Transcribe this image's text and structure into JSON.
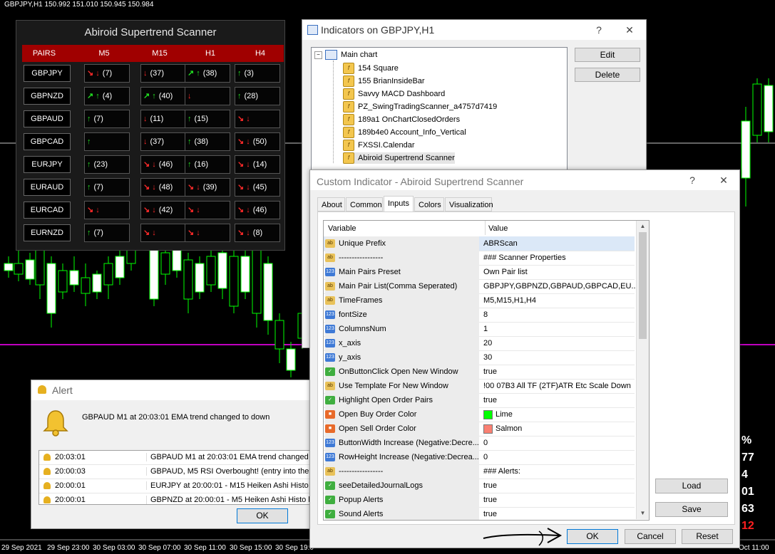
{
  "chart": {
    "title": "GBPJPY,H1  150.992 151.010 150.945 150.984",
    "time_labels": [
      "29 Sep 2021",
      "29 Sep 23:00",
      "30 Sep 03:00",
      "30 Sep 07:00",
      "30 Sep 11:00",
      "30 Sep 15:00",
      "30 Sep 19:0",
      "Oct 11:00"
    ],
    "side_values": [
      "%",
      "77",
      "4",
      "01",
      "63",
      "12"
    ],
    "colors": {
      "bull": "#00ff00",
      "magenta": "#ff00ff"
    }
  },
  "scanner": {
    "title": "Abiroid Supertrend Scanner",
    "headers": [
      "PAIRS",
      "M5",
      "M15",
      "H1",
      "H4"
    ],
    "rows": [
      {
        "pair": "GBPJPY",
        "cells": [
          {
            "a": "↘ ↓",
            "c": "dn",
            "v": "(7)"
          },
          {
            "a": "↓",
            "c": "dn",
            "v": "(37)"
          },
          {
            "a": "↗ ↑",
            "c": "up",
            "v": "(38)"
          },
          {
            "a": "↑",
            "c": "up",
            "v": "(3)"
          }
        ]
      },
      {
        "pair": "GBPNZD",
        "cells": [
          {
            "a": "↗ ↑",
            "c": "up",
            "v": "(4)"
          },
          {
            "a": "↗ ↑",
            "c": "up",
            "v": "(40)"
          },
          {
            "a": "↓",
            "c": "dn",
            "v": ""
          },
          {
            "a": "↑",
            "c": "up",
            "v": "(28)"
          }
        ]
      },
      {
        "pair": "GBPAUD",
        "cells": [
          {
            "a": "↑",
            "c": "up",
            "v": "(7)"
          },
          {
            "a": "↓",
            "c": "dn",
            "v": "(11)"
          },
          {
            "a": "↑",
            "c": "up",
            "v": "(15)"
          },
          {
            "a": "↘ ↓",
            "c": "dn",
            "v": ""
          }
        ]
      },
      {
        "pair": "GBPCAD",
        "cells": [
          {
            "a": "↑",
            "c": "up",
            "v": ""
          },
          {
            "a": "↓",
            "c": "dn",
            "v": "(37)"
          },
          {
            "a": "↑",
            "c": "up",
            "v": "(38)"
          },
          {
            "a": "↘ ↓",
            "c": "dn",
            "v": "(50)"
          }
        ]
      },
      {
        "pair": "EURJPY",
        "cells": [
          {
            "a": "↑",
            "c": "up",
            "v": "(23)"
          },
          {
            "a": "↘ ↓",
            "c": "dn",
            "v": "(46)"
          },
          {
            "a": "↑",
            "c": "up",
            "v": "(16)"
          },
          {
            "a": "↘ ↓",
            "c": "dn",
            "v": "(14)"
          }
        ]
      },
      {
        "pair": "EURAUD",
        "cells": [
          {
            "a": "↑",
            "c": "up",
            "v": "(7)"
          },
          {
            "a": "↘ ↓",
            "c": "dn",
            "v": "(48)"
          },
          {
            "a": "↘ ↓",
            "c": "dn",
            "v": "(39)"
          },
          {
            "a": "↘ ↓",
            "c": "dn",
            "v": "(45)"
          }
        ]
      },
      {
        "pair": "EURCAD",
        "cells": [
          {
            "a": "↘ ↓",
            "c": "dn",
            "v": ""
          },
          {
            "a": "↘ ↓",
            "c": "dn",
            "v": "(42)"
          },
          {
            "a": "↘ ↓",
            "c": "dn",
            "v": ""
          },
          {
            "a": "↘ ↓",
            "c": "dn",
            "v": "(46)"
          }
        ]
      },
      {
        "pair": "EURNZD",
        "cells": [
          {
            "a": "↑",
            "c": "up",
            "v": "(7)"
          },
          {
            "a": "↘ ↓",
            "c": "dn",
            "v": ""
          },
          {
            "a": "↘ ↓",
            "c": "dn",
            "v": ""
          },
          {
            "a": "↘ ↓",
            "c": "dn",
            "v": "(8)"
          }
        ]
      }
    ]
  },
  "indicators_window": {
    "title": "Indicators on GBPJPY,H1",
    "help": "?",
    "close": "✕",
    "root": "Main chart",
    "items": [
      "154 Square",
      "155 BrianInsideBar",
      "Savvy MACD Dashboard",
      "PZ_SwingTradingScanner_a4757d7419",
      "189a1 OnChartClosedOrders",
      "189b4e0 Account_Info_Vertical",
      "FXSSI.Calendar",
      "Abiroid Supertrend Scanner"
    ],
    "edit_label": "Edit",
    "delete_label": "Delete"
  },
  "custom_window": {
    "title": "Custom Indicator - Abiroid Supertrend Scanner",
    "help": "?",
    "close": "✕",
    "tabs": [
      "About",
      "Common",
      "Inputs",
      "Colors",
      "Visualization"
    ],
    "active_tab": "Inputs",
    "col_variable": "Variable",
    "col_value": "Value",
    "params": [
      {
        "t": "ab",
        "var": "Unique Prefix",
        "val": "ABRScan"
      },
      {
        "t": "ab",
        "var": "-----------------",
        "val": "### Scanner Properties"
      },
      {
        "t": "123",
        "var": "Main Pairs Preset",
        "val": "Own Pair list"
      },
      {
        "t": "ab",
        "var": "Main Pair List(Comma Seperated)",
        "val": "GBPJPY,GBPNZD,GBPAUD,GBPCAD,EU..."
      },
      {
        "t": "ab",
        "var": "TimeFrames",
        "val": "M5,M15,H1,H4"
      },
      {
        "t": "123",
        "var": "fontSize",
        "val": "8"
      },
      {
        "t": "123",
        "var": "ColumnsNum",
        "val": "1"
      },
      {
        "t": "123",
        "var": "x_axis",
        "val": "20"
      },
      {
        "t": "123",
        "var": "y_axis",
        "val": "30"
      },
      {
        "t": "bool",
        "var": "OnButtonClick Open New Window",
        "val": "true"
      },
      {
        "t": "ab",
        "var": "Use Template For New Window",
        "val": "!00 07B3 All TF (2TF)ATR Etc Scale Down"
      },
      {
        "t": "bool",
        "var": "Highlight Open Order Pairs",
        "val": "true"
      },
      {
        "t": "color",
        "var": "Open Buy Order Color",
        "val": "Lime",
        "swatch": "#00ff00"
      },
      {
        "t": "color",
        "var": "Open Sell Order Color",
        "val": "Salmon",
        "swatch": "#fa8072"
      },
      {
        "t": "123",
        "var": "ButtonWidth Increase (Negative:Decre...",
        "val": "0"
      },
      {
        "t": "123",
        "var": "RowHeight Increase (Negative:Decrea...",
        "val": "0"
      },
      {
        "t": "ab",
        "var": "-----------------",
        "val": "### Alerts:"
      },
      {
        "t": "bool",
        "var": "seeDetailedJournalLogs",
        "val": "true"
      },
      {
        "t": "bool",
        "var": "Popup Alerts",
        "val": "true"
      },
      {
        "t": "bool",
        "var": "Sound Alerts",
        "val": "true"
      }
    ],
    "load_label": "Load",
    "save_label": "Save",
    "ok_label": "OK",
    "cancel_label": "Cancel",
    "reset_label": "Reset"
  },
  "alert_window": {
    "title": "Alert",
    "message": "GBPAUD M1 at 20:03:01 EMA trend changed to down",
    "rows": [
      {
        "time": "20:03:01",
        "text": "GBPAUD M1 at 20:03:01 EMA trend changed to"
      },
      {
        "time": "20:00:03",
        "text": "GBPAUD, M5 RSI Overbought! (entry into the z"
      },
      {
        "time": "20:00:01",
        "text": "EURJPY at 20:00:01 - M15 Heiken Ashi Histo  bu"
      },
      {
        "time": "20:00:01",
        "text": "GBPNZD at 20:00:01 - M5 Heiken Ashi Histo  bu"
      }
    ],
    "ok_label": "OK"
  }
}
